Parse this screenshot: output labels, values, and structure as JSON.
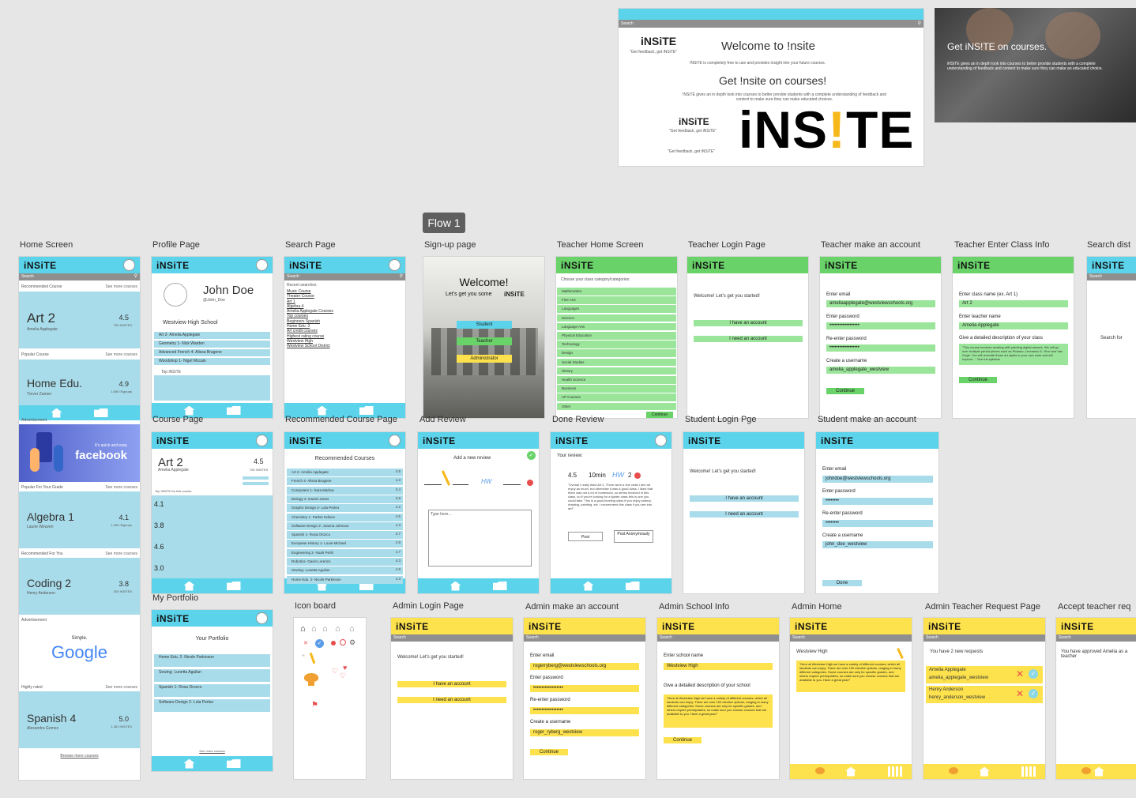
{
  "flow_badge": "Flow 1",
  "labels": {
    "home": "Home Screen",
    "profile": "Profile Page",
    "search": "Search Page",
    "signup": "Sign-up page",
    "teacher_home": "Teacher Home Screen",
    "teacher_login": "Teacher Login Page",
    "teacher_make": "Teacher make an account",
    "teacher_class": "Teacher Enter Class Info",
    "search_dist": "Search dist",
    "course": "Course Page",
    "recommended": "Recommended Course Page",
    "add_review": "Add Review",
    "done_review": "Done Review",
    "student_login": "Student Login Pge",
    "student_make": "Student make an account",
    "portfolio": "My Portfolio",
    "icon_board": "Icon board",
    "admin_login": "Admin Login Page",
    "admin_make": "Admin make an account",
    "admin_school": "Admin School Info",
    "admin_home": "Admin Home",
    "admin_teacher": "Admin Teacher Request Page",
    "accept_teacher": "Accept teacher req"
  },
  "logo": {
    "main": "iNS",
    "excl": "!",
    "end": "TE",
    "small": "iNSiTE",
    "tagline": "\"Get feedback, get iNSiTE\""
  },
  "search_text": "Search",
  "hero": {
    "welcome": "Welcome to !nsite",
    "welcome_desc": "!NSiTE is completely free to use and provides insight into your future courses.",
    "get": "Get !nsite on courses!",
    "get_desc": "!NSiTE gives an in depth look into courses to better provide students with a complete understanding of feedback and content to make sure they can make educated choices.",
    "photo_title": "Get iNS!TE on courses.",
    "photo_desc": "iNSiTE gives an in depth look into courses to better provide students with a complete understanding of feedback and content to make sure they can make an educated choice."
  },
  "home": {
    "sec1": "Recommended Course",
    "see": "See more courses",
    "art": "Art 2",
    "art_teacher": "Amelia Applegate",
    "art_rating": "4.5",
    "art_count": "750 !NSITES",
    "sec2": "Popular Course",
    "home_edu": "Home Edu.",
    "home_teacher": "Trevor Zamen",
    "home_rating": "4.9",
    "home_count": "1,690 !Signups",
    "ad": "Advertisement",
    "fb_small": "It's quick and easy",
    "fb_big": "facebook",
    "sec3": "Popular For Your Grade",
    "alg": "Algebra 1",
    "alg_teacher": "Laurie Weaven",
    "alg_rating": "4.1",
    "alg_count": "1,050 !Signups",
    "sec4": "Recommended For You",
    "coding": "Coding 2",
    "coding_teacher": "Henry Anderson",
    "coding_rating": "3.8",
    "coding_count": "300 !NSITES",
    "ad2": "Advertisement",
    "google_simple": "Simple.",
    "google": "Google",
    "sec5": "Highly rated",
    "spanish": "Spanish 4",
    "spanish_teacher": "Alexandra Gomez",
    "spanish_rating": "5.0",
    "spanish_count": "1,381 !NSITES",
    "browse": "Browse more courses"
  },
  "profile": {
    "name": "John Doe",
    "handle": "@John_Doe",
    "school": "Westview High School",
    "courses": [
      "Art 2- Amelia Applegate",
      "Geometry 1- Nick Warden",
      "Advanced French 4- Alissa Brugene",
      "Woodshop 1- Nigel Mccain"
    ],
    "top": "Top iNSiTE"
  },
  "search": {
    "recent": "Recent searches",
    "items": [
      "Music Course",
      "Theater Course",
      "Art 1",
      "Algebra 4",
      "Amelia Applegate Courses",
      "Top courses",
      "Beginners Spanish",
      "Home Edu. 3",
      "Art credit courses",
      "Highest rating course",
      "Westview High",
      "Westview School District"
    ]
  },
  "signup": {
    "welcome": "Welcome!",
    "sub": "Let's get you some",
    "student": "Student",
    "teacher": "Teacher",
    "admin": "Administrator"
  },
  "teacher_home": {
    "prompt": "Choose your class category/categories:",
    "cats": [
      "Mathematics",
      "Fine Arts",
      "Languages",
      "Science",
      "Language Arts",
      "Physical Education",
      "Technology",
      "Design",
      "Social Studies",
      "History",
      "Health Science",
      "Business",
      "AP Courses",
      "Other"
    ],
    "continue": "Continue"
  },
  "login": {
    "welcome": "Welcome! Let's get you started!",
    "have": "I have an account",
    "need": "I need an account"
  },
  "tmake": {
    "email_l": "Enter email",
    "email": "ameliaapplegate@westviewschools.org",
    "pw_l": "Enter password",
    "pw": "••••••••••••••••••",
    "re_l": "Re-enter password",
    "re": "••••••••••••••••••",
    "user_l": "Create a username",
    "user": "amelia_applegate_westview",
    "continue": "Continue"
  },
  "tclass": {
    "name_l": "Enter class name (ex. Art 1)",
    "name": "Art 2",
    "teacher_l": "Enter teacher name",
    "teacher": "Amelia Applegate",
    "desc_l": "Give a detailed description of your class",
    "desc": "\"This course involves working with painting digital artwork. We will go over multiple period pieces such as Picasso, Leonardo D. Vinci and Van Gogh. You will recreate these art styles in your own work and will explore...\" See full syllabus",
    "continue": "Continue"
  },
  "sdist": {
    "text": "Search for"
  },
  "course": {
    "title": "Art 2",
    "teacher": "Amelia Applegate",
    "rating": "4.5",
    "count": "750 !NSITES",
    "top": "Top !NSiTE for this course",
    "ratings": [
      "4.1",
      "3.8",
      "4.6",
      "3.0"
    ]
  },
  "recommended": {
    "title": "Recommended Courses",
    "items": [
      "Art 2- Amelia Applegate",
      "French 4- Alissa Brugene",
      "Computers 1- Sara Marlow",
      "Biology 2- Daniel Jones",
      "Graphic Design 2- Lola Perleo",
      "Chemistry 1- Parker Edison",
      "Software Design 2- Joanna Johnson",
      "Spanish 1- Rosa Orozco",
      "European History 1- Louie Michael",
      "Engineering 2- Noah Perlit",
      "Robotics- Gavin Lorenzo",
      "Sewing- Lunetta Aguilan",
      "Home Edu. 2- Nicole Parkinson"
    ],
    "scores": [
      "4.5",
      "4.3",
      "3.4",
      "3.8",
      "4.2",
      "4.5",
      "4.3",
      "3.7",
      "2.8",
      "4.7",
      "4.3",
      "4.9",
      "4.3"
    ]
  },
  "add_review": {
    "title": "Add a new review",
    "hw": "HW",
    "type": "Type here..."
  },
  "done_review": {
    "label": "Your review:",
    "r1": "4.5",
    "r2": "10min",
    "r3": "HW",
    "r4": "2",
    "text": "\"Overall I really liked Art 2. There were a few visits I did not enjoy as much, but otherwise it was a good class. I liked that there was not a lot of homework, so stress involved in this class, so if you're looking for a lighter class this is one you could take. This is a good leveling class if you enjoy pottery, drawing, painting, etc. I recommend this class if you are into art!\"",
    "post": "Post",
    "post_anon": "Post Anonymously"
  },
  "smake": {
    "email_l": "Enter email",
    "email": "johndoe@westviewschools.org",
    "pw_l": "Enter password",
    "pw": "••••••••",
    "re_l": "Re-enter password",
    "re": "••••••••",
    "user_l": "Create a username",
    "user": "john_doe_westview",
    "done": "Done"
  },
  "portfolio": {
    "title": "Your Portfolio",
    "items": [
      "Home Edu. 2- Nicole Parkinson",
      "Sewing- Lunetta Aguilan",
      "Spanish 1- Rosa Orozco",
      "Software Design 2- Lola Perleo"
    ],
    "see": "See more courses"
  },
  "admake": {
    "email_l": "Enter email",
    "email": "rogerryberg@westviewschools.org",
    "pw_l": "Enter password",
    "pw": "••••••••••••••••••",
    "re_l": "Re-enter password",
    "re": "••••••••••••••••••",
    "user_l": "Create a username",
    "user": "roger_ryberg_westview",
    "continue": "Continue"
  },
  "adschool": {
    "name_l": "Enter school name",
    "name": "Westview High",
    "desc_l": "Give a detailed description of your school",
    "desc": "\"Here at Westview High we have a variety of different courses, which all students can enjoy. There are over 100 elective options, ranging in many different categories. Some courses are only for specific grades, and others require prerequisites, so make sure you choose courses that are available to you. Have a great year!\"",
    "continue": "Continue"
  },
  "adhome": {
    "school": "Westview High",
    "desc": "\"Here at Westview High we have a variety of different courses, which all students can enjoy. There are over 100 elective options, ranging in many different categories. Some courses are only for specific grades, and others require prerequisites, so make sure you choose courses that are available to you. Have a great year!\""
  },
  "adteacher": {
    "head": "You have 2 new requests",
    "r1_name": "Amelia Applegate",
    "r1_user": "amelia_applegate_westview",
    "r2_name": "Henry Anderson",
    "r2_user": "henry_anderson_westview"
  },
  "accept": {
    "text": "You have approved Amelia as a teacher"
  }
}
